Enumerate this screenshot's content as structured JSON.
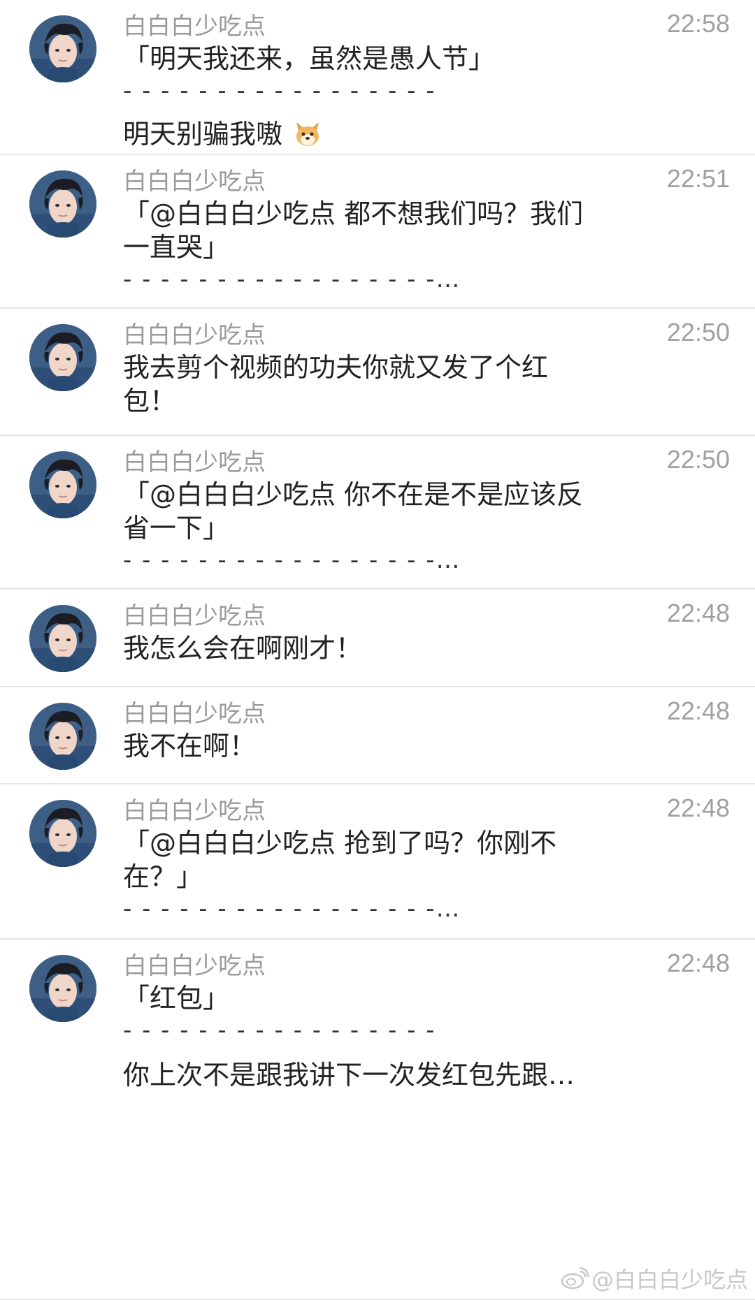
{
  "messages": [
    {
      "name": "白白白少吃点",
      "time": "22:58",
      "lines": [
        "「明天我还来，虽然是愚人节」"
      ],
      "divider": "- - - - - - - - - - - - - - - - -",
      "reply": "明天别骗我嗷"
    },
    {
      "name": "白白白少吃点",
      "time": "22:51",
      "lines": [
        "「@白白白少吃点 都不想我们吗？我们",
        "一直哭」"
      ],
      "divider": "- - - - - - - - - - - - - - - - -…",
      "reply": ""
    },
    {
      "name": "白白白少吃点",
      "time": "22:50",
      "lines": [
        "我去剪个视频的功夫你就又发了个红",
        "包！"
      ],
      "divider": "",
      "reply": ""
    },
    {
      "name": "白白白少吃点",
      "time": "22:50",
      "lines": [
        "「@白白白少吃点 你不在是不是应该反",
        "省一下」"
      ],
      "divider": "- - - - - - - - - - - - - - - - -…",
      "reply": ""
    },
    {
      "name": "白白白少吃点",
      "time": "22:48",
      "lines": [
        "我怎么会在啊刚才！"
      ],
      "divider": "",
      "reply": ""
    },
    {
      "name": "白白白少吃点",
      "time": "22:48",
      "lines": [
        "我不在啊！"
      ],
      "divider": "",
      "reply": ""
    },
    {
      "name": "白白白少吃点",
      "time": "22:48",
      "lines": [
        "「@白白白少吃点 抢到了吗？你刚不",
        "在？」"
      ],
      "divider": "- - - - - - - - - - - - - - - - -…",
      "reply": ""
    },
    {
      "name": "白白白少吃点",
      "time": "22:48",
      "lines": [
        "「红包」"
      ],
      "divider": "- - - - - - - - - - - - - - - - -",
      "reply": "你上次不是跟我讲下一次发红包先跟…"
    }
  ],
  "watermark": "@白白白少吃点",
  "icons": {
    "avatar": "avatar-photo",
    "emoji": "dog-face-emoji",
    "watermark": "weibo-logo-icon"
  },
  "colors": {
    "name": "#9a9a9a",
    "time": "#a0a0a0",
    "text": "#222222",
    "border": "#e6e6e6",
    "avatar_bg": "#3d5f86"
  }
}
